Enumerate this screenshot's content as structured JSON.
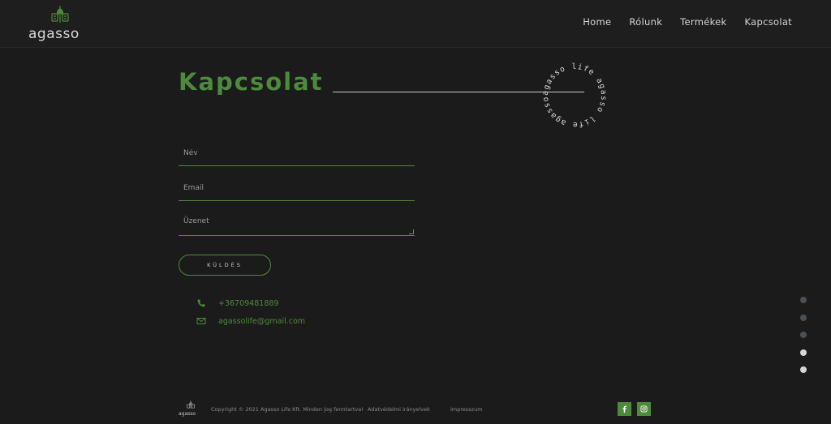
{
  "brand": {
    "name": "agasso",
    "accent_color": "#4e8a3c"
  },
  "nav": {
    "items": [
      {
        "label": "Home"
      },
      {
        "label": "Rólunk"
      },
      {
        "label": "Termékek"
      },
      {
        "label": "Kapcsolat"
      }
    ]
  },
  "main": {
    "title": "Kapcsolat",
    "badge_text": "agasso life agasso life agasso life"
  },
  "form": {
    "name_placeholder": "Név",
    "email_placeholder": "Email",
    "message_placeholder": "Üzenet",
    "submit_label": "KÜLDÉS"
  },
  "contact": {
    "phone": "+36709481889",
    "email": "agassolife@gmail.com"
  },
  "side_dots": {
    "count": 5,
    "colors": [
      "#4a5058",
      "#4a5058",
      "#4a5058",
      "#d6d6d6",
      "#d6d6d6"
    ]
  },
  "footer": {
    "logo_text": "agasso",
    "copyright": "Copyright © 2021 Agasso Life Kft. Minden jog fenntartva!",
    "privacy_label": "Adatvédelmi irányelvek",
    "imprint_label": "Impresszum",
    "social_icons": [
      "facebook-icon",
      "instagram-icon"
    ]
  }
}
